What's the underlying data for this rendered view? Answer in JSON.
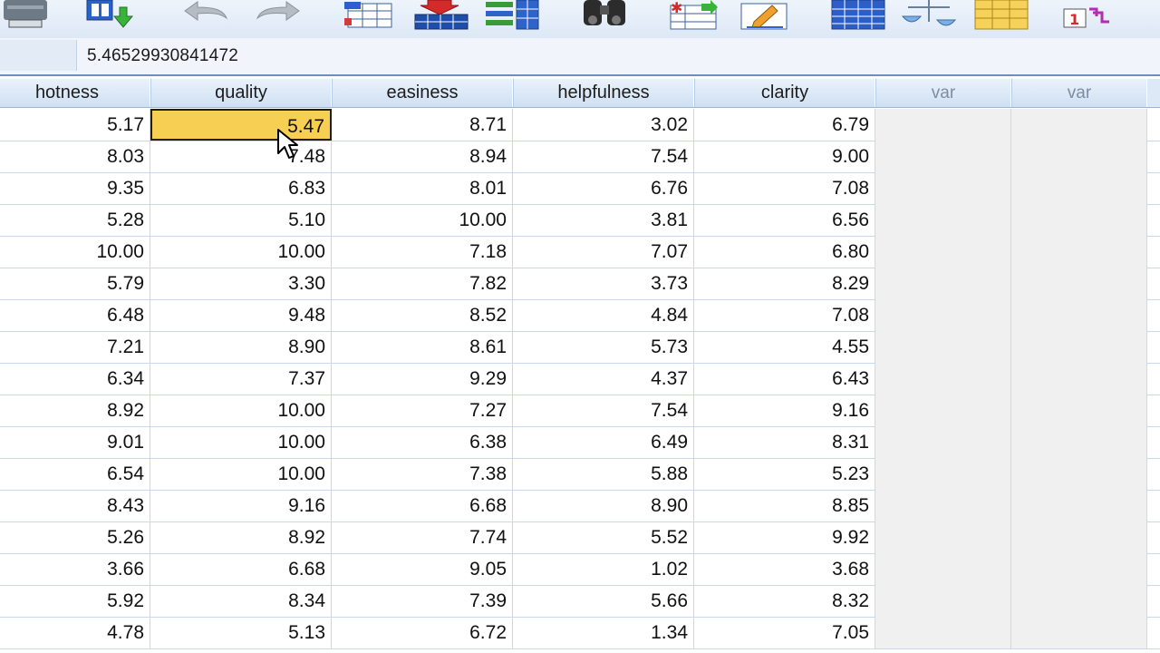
{
  "toolbar": {
    "buttons": [
      {
        "name": "print-icon"
      },
      {
        "name": "import-data-icon"
      },
      {
        "name": "undo-icon"
      },
      {
        "name": "redo-icon"
      },
      {
        "name": "goto-case-icon"
      },
      {
        "name": "goto-variable-icon"
      },
      {
        "name": "variables-icon"
      },
      {
        "name": "find-icon"
      },
      {
        "name": "insert-cases-icon"
      },
      {
        "name": "insert-variable-icon"
      },
      {
        "name": "split-file-icon"
      },
      {
        "name": "weight-cases-icon"
      },
      {
        "name": "select-cases-icon"
      },
      {
        "name": "value-labels-icon"
      }
    ]
  },
  "editbar": {
    "cell_value": "5.46529930841472"
  },
  "grid": {
    "headers": [
      "hotness",
      "quality",
      "easiness",
      "helpfulness",
      "clarity",
      "var",
      "var"
    ],
    "selected": {
      "row": 0,
      "col": 1
    },
    "rows": [
      [
        "5.17",
        "5.47",
        "8.71",
        "3.02",
        "6.79"
      ],
      [
        "8.03",
        "7.48",
        "8.94",
        "7.54",
        "9.00"
      ],
      [
        "9.35",
        "6.83",
        "8.01",
        "6.76",
        "7.08"
      ],
      [
        "5.28",
        "5.10",
        "10.00",
        "3.81",
        "6.56"
      ],
      [
        "10.00",
        "10.00",
        "7.18",
        "7.07",
        "6.80"
      ],
      [
        "5.79",
        "3.30",
        "7.82",
        "3.73",
        "8.29"
      ],
      [
        "6.48",
        "9.48",
        "8.52",
        "4.84",
        "7.08"
      ],
      [
        "7.21",
        "8.90",
        "8.61",
        "5.73",
        "4.55"
      ],
      [
        "6.34",
        "7.37",
        "9.29",
        "4.37",
        "6.43"
      ],
      [
        "8.92",
        "10.00",
        "7.27",
        "7.54",
        "9.16"
      ],
      [
        "9.01",
        "10.00",
        "6.38",
        "6.49",
        "8.31"
      ],
      [
        "6.54",
        "10.00",
        "7.38",
        "5.88",
        "5.23"
      ],
      [
        "8.43",
        "9.16",
        "6.68",
        "8.90",
        "8.85"
      ],
      [
        "5.26",
        "8.92",
        "7.74",
        "5.52",
        "9.92"
      ],
      [
        "3.66",
        "6.68",
        "9.05",
        "1.02",
        "3.68"
      ],
      [
        "5.92",
        "8.34",
        "7.39",
        "5.66",
        "8.32"
      ],
      [
        "4.78",
        "5.13",
        "6.72",
        "1.34",
        "7.05"
      ]
    ]
  },
  "colors": {
    "selected_cell": "#f7cf52",
    "header_bg": "#dde9f7",
    "empty_cell": "#f0f0f0"
  }
}
